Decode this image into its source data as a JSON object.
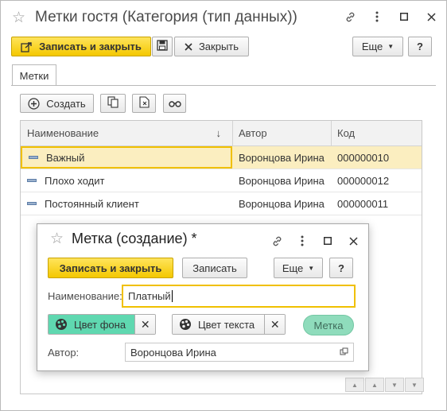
{
  "window": {
    "title": "Метки гостя (Категория (тип данных))",
    "toolbar": {
      "save_close": "Записать и закрыть",
      "close": "Закрыть",
      "more": "Еще",
      "help": "?"
    },
    "tab": "Метки",
    "list_toolbar": {
      "create": "Создать"
    },
    "columns": {
      "name": "Наименование",
      "sort_indicator": "↓",
      "author": "Автор",
      "code": "Код"
    },
    "rows": [
      {
        "name": "Важный",
        "author": "Воронцова Ирина",
        "code": "000000010",
        "selected": true
      },
      {
        "name": "Плохо ходит",
        "author": "Воронцова Ирина",
        "code": "000000012",
        "selected": false
      },
      {
        "name": "Постоянный клиент",
        "author": "Воронцова Ирина",
        "code": "000000011",
        "selected": false
      }
    ]
  },
  "dialog": {
    "title": "Метка (создание) *",
    "save_close": "Записать и закрыть",
    "save": "Записать",
    "more": "Еще",
    "help": "?",
    "name_label": "Наименование:",
    "name_value": "Платный",
    "bg_color_button": "Цвет фона",
    "text_color_button": "Цвет текста",
    "preview": "Метка",
    "author_label": "Автор:",
    "author_value": "Воронцова Ирина"
  },
  "colors": {
    "accent_yellow": "#f4c800",
    "selection": "#fbeec0",
    "label_bg": "#8fdcbc",
    "bg_chip": "#5fd8b0"
  },
  "icons": [
    "star-icon",
    "link-icon",
    "more-icon",
    "maximize-icon",
    "close-icon",
    "save-close-icon",
    "disk-icon",
    "copy-icon",
    "delete-mark-icon",
    "find-icon",
    "palette-icon",
    "open-icon"
  ]
}
